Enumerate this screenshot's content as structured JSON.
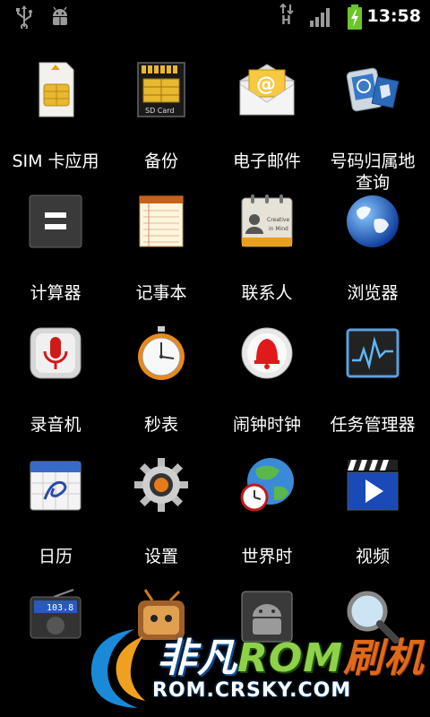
{
  "status_bar": {
    "time": "13:58",
    "network_type": "H",
    "left_icons": [
      "usb-icon",
      "android-debug-icon"
    ],
    "right_icons": [
      "data-transfer-icon",
      "signal-icon",
      "battery-charging-icon"
    ]
  },
  "apps": [
    {
      "label": "SIM 卡应用",
      "icon": "sim-card-icon"
    },
    {
      "label": "备份",
      "icon": "sd-card-icon"
    },
    {
      "label": "电子邮件",
      "icon": "email-icon"
    },
    {
      "label": "号码归属地查询",
      "icon": "phone-lookup-icon"
    },
    {
      "label": "计算器",
      "icon": "calculator-icon"
    },
    {
      "label": "记事本",
      "icon": "notepad-icon"
    },
    {
      "label": "联系人",
      "icon": "contacts-icon"
    },
    {
      "label": "浏览器",
      "icon": "browser-globe-icon"
    },
    {
      "label": "录音机",
      "icon": "microphone-icon"
    },
    {
      "label": "秒表",
      "icon": "stopwatch-icon"
    },
    {
      "label": "闹钟时钟",
      "icon": "alarm-bell-icon"
    },
    {
      "label": "任务管理器",
      "icon": "task-monitor-icon"
    },
    {
      "label": "日历",
      "icon": "calendar-icon"
    },
    {
      "label": "设置",
      "icon": "settings-gear-icon"
    },
    {
      "label": "世界时",
      "icon": "world-clock-icon"
    },
    {
      "label": "视频",
      "icon": "video-player-icon"
    },
    {
      "label": "",
      "icon": "radio-icon"
    },
    {
      "label": "",
      "icon": "tv-character-icon"
    },
    {
      "label": "",
      "icon": "android-market-icon"
    },
    {
      "label": "",
      "icon": "magnifier-icon"
    }
  ],
  "contacts_card_text": "Creative in Mind",
  "sd_card_text": "SD Card",
  "radio_freq": "103.8",
  "watermark": {
    "brand_part1": "非凡",
    "brand_part2": "ROM",
    "brand_part3": "刷机",
    "url": "ROM.CRSKY.COM"
  }
}
